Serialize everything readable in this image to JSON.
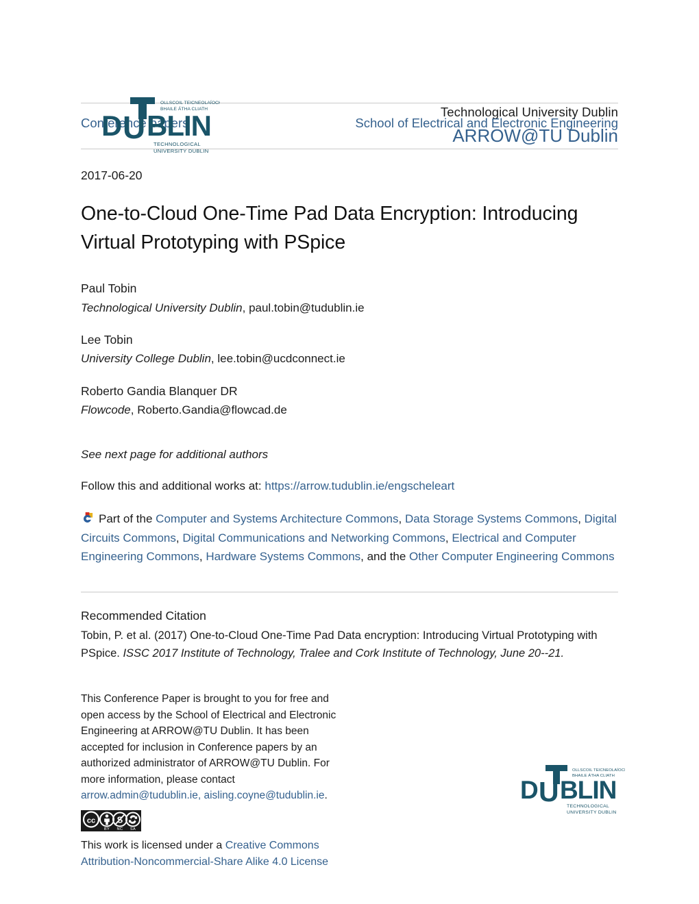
{
  "logo": {
    "wordmark": "DUBLIN",
    "letter_t": "T",
    "irish_line1": "OLLSCOIL TEICNEOLAÍOCHTA",
    "irish_line2": "BHAILE ÁTHA CLIATH",
    "sub_line1": "TECHNOLOGICAL",
    "sub_line2": "UNIVERSITY DUBLIN",
    "color": "#1a5468"
  },
  "masthead": {
    "university": "Technological University Dublin",
    "repository": "ARROW@TU Dublin",
    "link_color": "#35618e"
  },
  "series": {
    "left": "Conference papers",
    "right": "School of Electrical and Electronic Engineering"
  },
  "publication": {
    "date": "2017-06-20",
    "title": "One-to-Cloud One-Time Pad Data Encryption: Introducing Virtual Prototyping with PSpice"
  },
  "authors": [
    {
      "name": "Paul Tobin",
      "affiliation": "Technological University Dublin",
      "email": "paul.tobin@tudublin.ie"
    },
    {
      "name": "Lee Tobin",
      "affiliation": "University College Dublin",
      "email": "lee.tobin@ucdconnect.ie"
    },
    {
      "name": "Roberto Gandia Blanquer DR",
      "affiliation": "Flowcode",
      "email": "Roberto.Gandia@flowcad.de"
    }
  ],
  "see_next_page": "See next page for additional authors",
  "follow": {
    "label": "Follow this and additional works at: ",
    "url": "https://arrow.tudublin.ie/engscheleart"
  },
  "commons": {
    "icon": "digital-commons-icon",
    "prefix": "Part of the ",
    "links": [
      "Computer and Systems Architecture Commons",
      "Data Storage Systems Commons",
      "Digital Circuits Commons",
      "Digital Communications and Networking Commons",
      "Electrical and Computer Engineering Commons",
      "Hardware Systems Commons",
      "Other Computer Engineering Commons"
    ],
    "separator": ", ",
    "conjunction": ", and the "
  },
  "citation": {
    "heading": "Recommended Citation",
    "text_plain": "Tobin, P. et al. (2017) One-to-Cloud One-Time Pad Data encryption: Introducing Virtual Prototyping with PSpice. ",
    "text_italic": "ISSC 2017 Institute of Technology, Tralee and Cork Institute of Technology, June 20--21."
  },
  "footer": {
    "notice_part1": "This Conference Paper is brought to you for free and open access by the School of Electrical and Electronic Engineering at ARROW@TU Dublin. It has been accepted for inclusion in Conference papers by an authorized administrator of ARROW@TU Dublin. For more information, please contact ",
    "contact_email_1": "arrow.admin@tudublin.ie,",
    "contact_email_2": "aisling.coyne@tudublin.ie",
    "notice_end": ".",
    "license_prefix": "This work is licensed under a ",
    "license_link": "Creative Commons Attribution-Noncommercial-Share Alike 4.0 License",
    "cc_badge": {
      "cc": "cc",
      "by": "BY",
      "nc": "NC",
      "sa": "SA"
    }
  }
}
